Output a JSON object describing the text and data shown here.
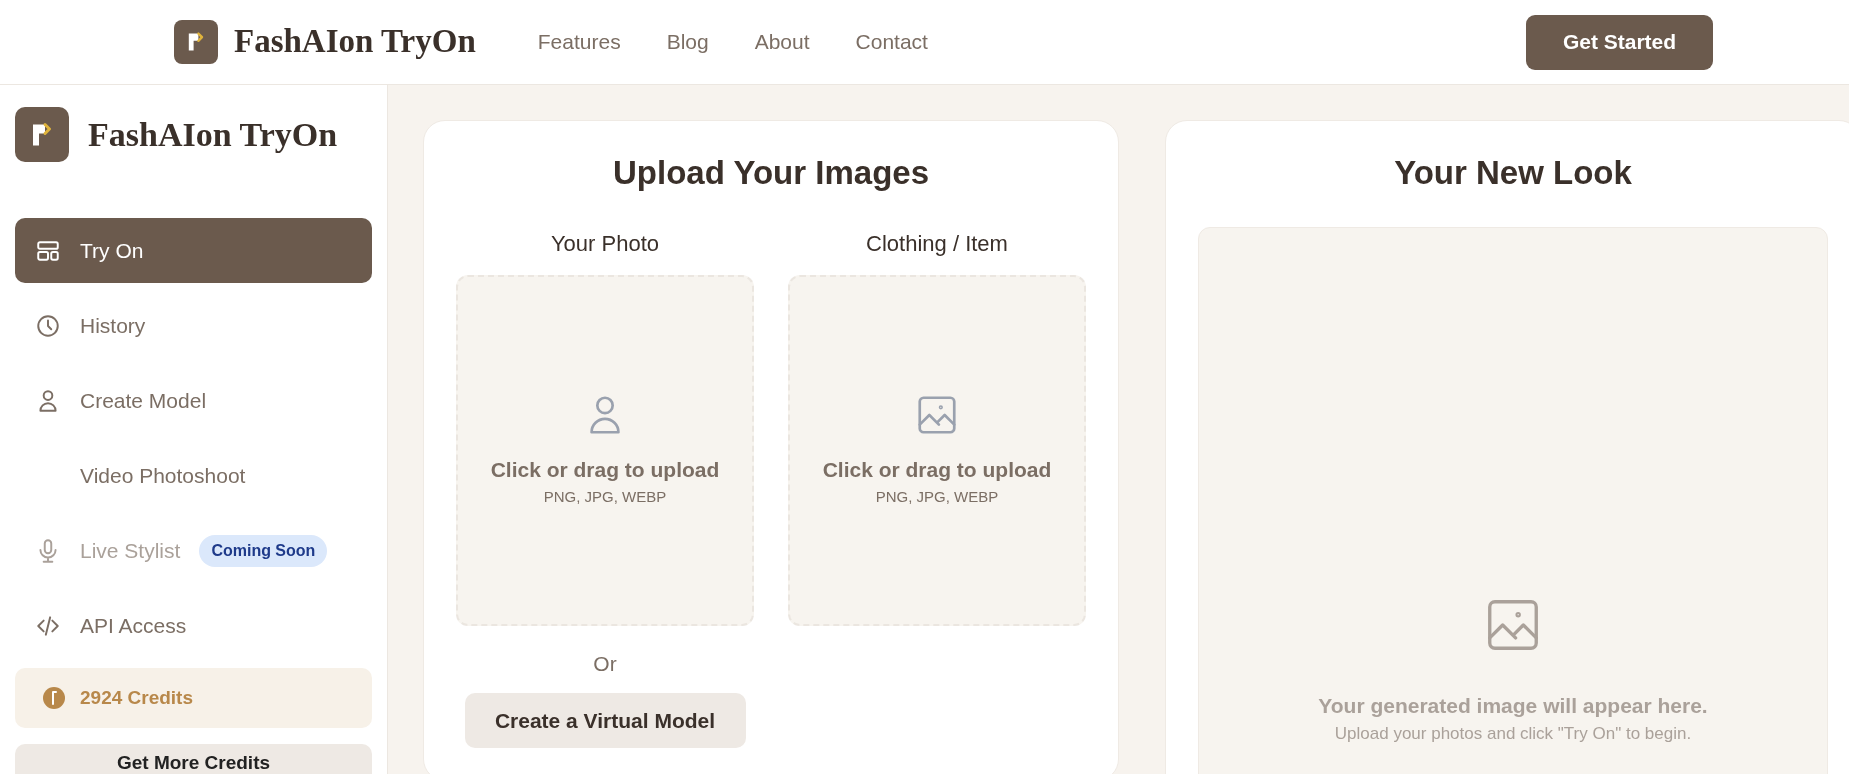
{
  "header": {
    "brand": "FashAIon TryOn",
    "nav": [
      "Features",
      "Blog",
      "About",
      "Contact"
    ],
    "cta": "Get Started"
  },
  "sidebar": {
    "brand": "FashAIon TryOn",
    "items": [
      {
        "label": "Try On",
        "selected": true,
        "disabled": false
      },
      {
        "label": "History",
        "selected": false,
        "disabled": false
      },
      {
        "label": "Create Model",
        "selected": false,
        "disabled": false
      },
      {
        "label": "Video Photoshoot",
        "selected": false,
        "disabled": false
      },
      {
        "label": "Live Stylist",
        "selected": false,
        "disabled": true,
        "badge": "Coming Soon"
      },
      {
        "label": "API Access",
        "selected": false,
        "disabled": false
      }
    ],
    "credits": "2924 Credits",
    "more_button": "Get More Credits"
  },
  "upload": {
    "title": "Upload Your Images",
    "slots": [
      {
        "label": "Your Photo",
        "prompt": "Click or drag to upload",
        "formats": "PNG, JPG, WEBP",
        "kind": "person"
      },
      {
        "label": "Clothing / Item",
        "prompt": "Click or drag to upload",
        "formats": "PNG, JPG, WEBP",
        "kind": "image"
      }
    ],
    "or": "Or",
    "virtual_button": "Create a Virtual Model"
  },
  "result": {
    "title": "Your New Look",
    "message": "Your generated image will appear here.",
    "hint": "Upload your photos and click \"Try On\" to begin."
  }
}
